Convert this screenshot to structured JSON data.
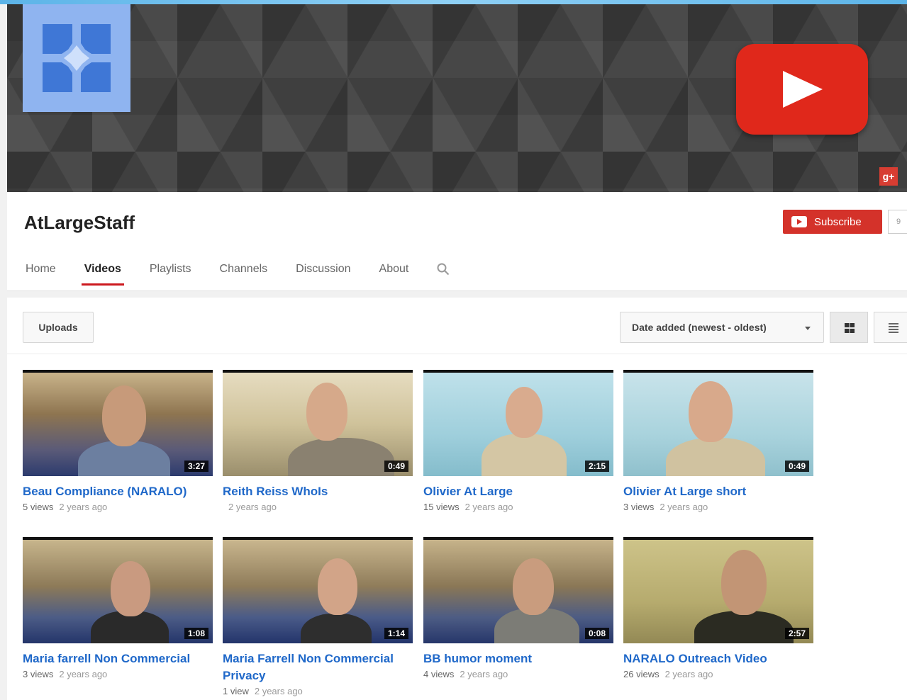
{
  "channel": {
    "name": "AtLargeStaff",
    "subscribe_label": "Subscribe",
    "subscriber_count": "9"
  },
  "tabs": [
    {
      "label": "Home"
    },
    {
      "label": "Videos"
    },
    {
      "label": "Playlists"
    },
    {
      "label": "Channels"
    },
    {
      "label": "Discussion"
    },
    {
      "label": "About"
    }
  ],
  "toolbar": {
    "uploads_label": "Uploads",
    "sort_label": "Date added (newest - oldest)"
  },
  "videos": [
    {
      "title": "Beau Compliance (NARALO)",
      "duration": "3:27",
      "views": "5 views",
      "age": "2 years ago"
    },
    {
      "title": "Reith Reiss WhoIs",
      "duration": "0:49",
      "views": "",
      "age": "2 years ago"
    },
    {
      "title": "Olivier At Large",
      "duration": "2:15",
      "views": "15 views",
      "age": "2 years ago"
    },
    {
      "title": "Olivier At Large short",
      "duration": "0:49",
      "views": "3 views",
      "age": "2 years ago"
    },
    {
      "title": "Maria farrell Non Commercial",
      "duration": "1:08",
      "views": "3 views",
      "age": "2 years ago"
    },
    {
      "title": "Maria Farrell Non Commercial Privacy",
      "duration": "1:14",
      "views": "1 view",
      "age": "2 years ago"
    },
    {
      "title": "BB humor moment",
      "duration": "0:08",
      "views": "4 views",
      "age": "2 years ago"
    },
    {
      "title": "NARALO Outreach Video",
      "duration": "2:57",
      "views": "26 views",
      "age": "2 years ago"
    }
  ],
  "icons": {
    "logo": "youtube-play-icon",
    "social": "google-plus-icon",
    "search": "search-icon",
    "grid_view": "grid-view-icon",
    "list_view": "list-view-icon"
  },
  "colors": {
    "brand_red": "#e0281b",
    "link_blue": "#1f68c9",
    "avatar_blue": "#8fb4f0"
  }
}
